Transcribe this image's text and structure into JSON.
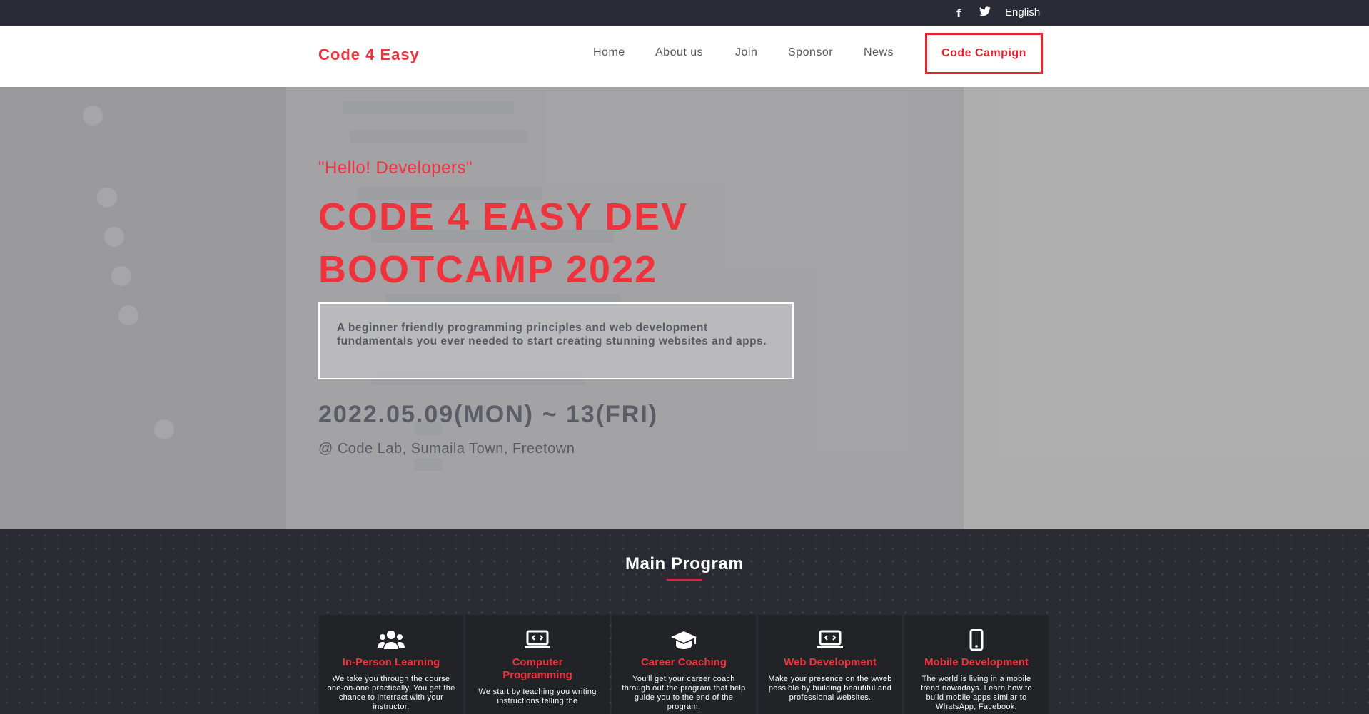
{
  "topbar": {
    "facebook_icon": "facebook-icon",
    "twitter_icon": "twitter-icon",
    "language": "English"
  },
  "navbar": {
    "logo": "Code 4 Easy",
    "items": [
      "Home",
      "About us",
      "Join",
      "Sponsor",
      "News"
    ],
    "cta": "Code Campign"
  },
  "hero": {
    "greeting": "\"Hello! Developers\"",
    "title": "Code 4 Easy Dev Bootcamp 2022",
    "description": "A beginner friendly programming principles and web development fundamentals you ever needed to start creating stunning websites and apps.",
    "date": "2022.05.09(MON) ~ 13(FRI)",
    "venue": "@ Code Lab, Sumaila Town, Freetown"
  },
  "program": {
    "heading": "Main Program",
    "cards": [
      {
        "icon": "users-icon",
        "title": "In-Person Learning",
        "text": "We take you through the course one-on-one practically. You get the chance to interract with your instructor."
      },
      {
        "icon": "laptop-code-icon",
        "title": "Computer Programming",
        "text": "We start by teaching you writing instructions telling the"
      },
      {
        "icon": "graduation-cap-icon",
        "title": "Career Coaching",
        "text": "You'll get your career coach through out the program that help guide you to the end of the program."
      },
      {
        "icon": "laptop-code-icon",
        "title": "Web Development",
        "text": "Make your presence on the wweb possible by building beautiful and professional websites."
      },
      {
        "icon": "mobile-icon",
        "title": "Mobile Development",
        "text": "The world is living in a mobile trend nowadays. Learn how to build mobile apps similar to WhatsApp, Facebook."
      }
    ]
  },
  "colors": {
    "accent": "#f0323d",
    "dark": "#2a2b33",
    "card": "#222327"
  }
}
